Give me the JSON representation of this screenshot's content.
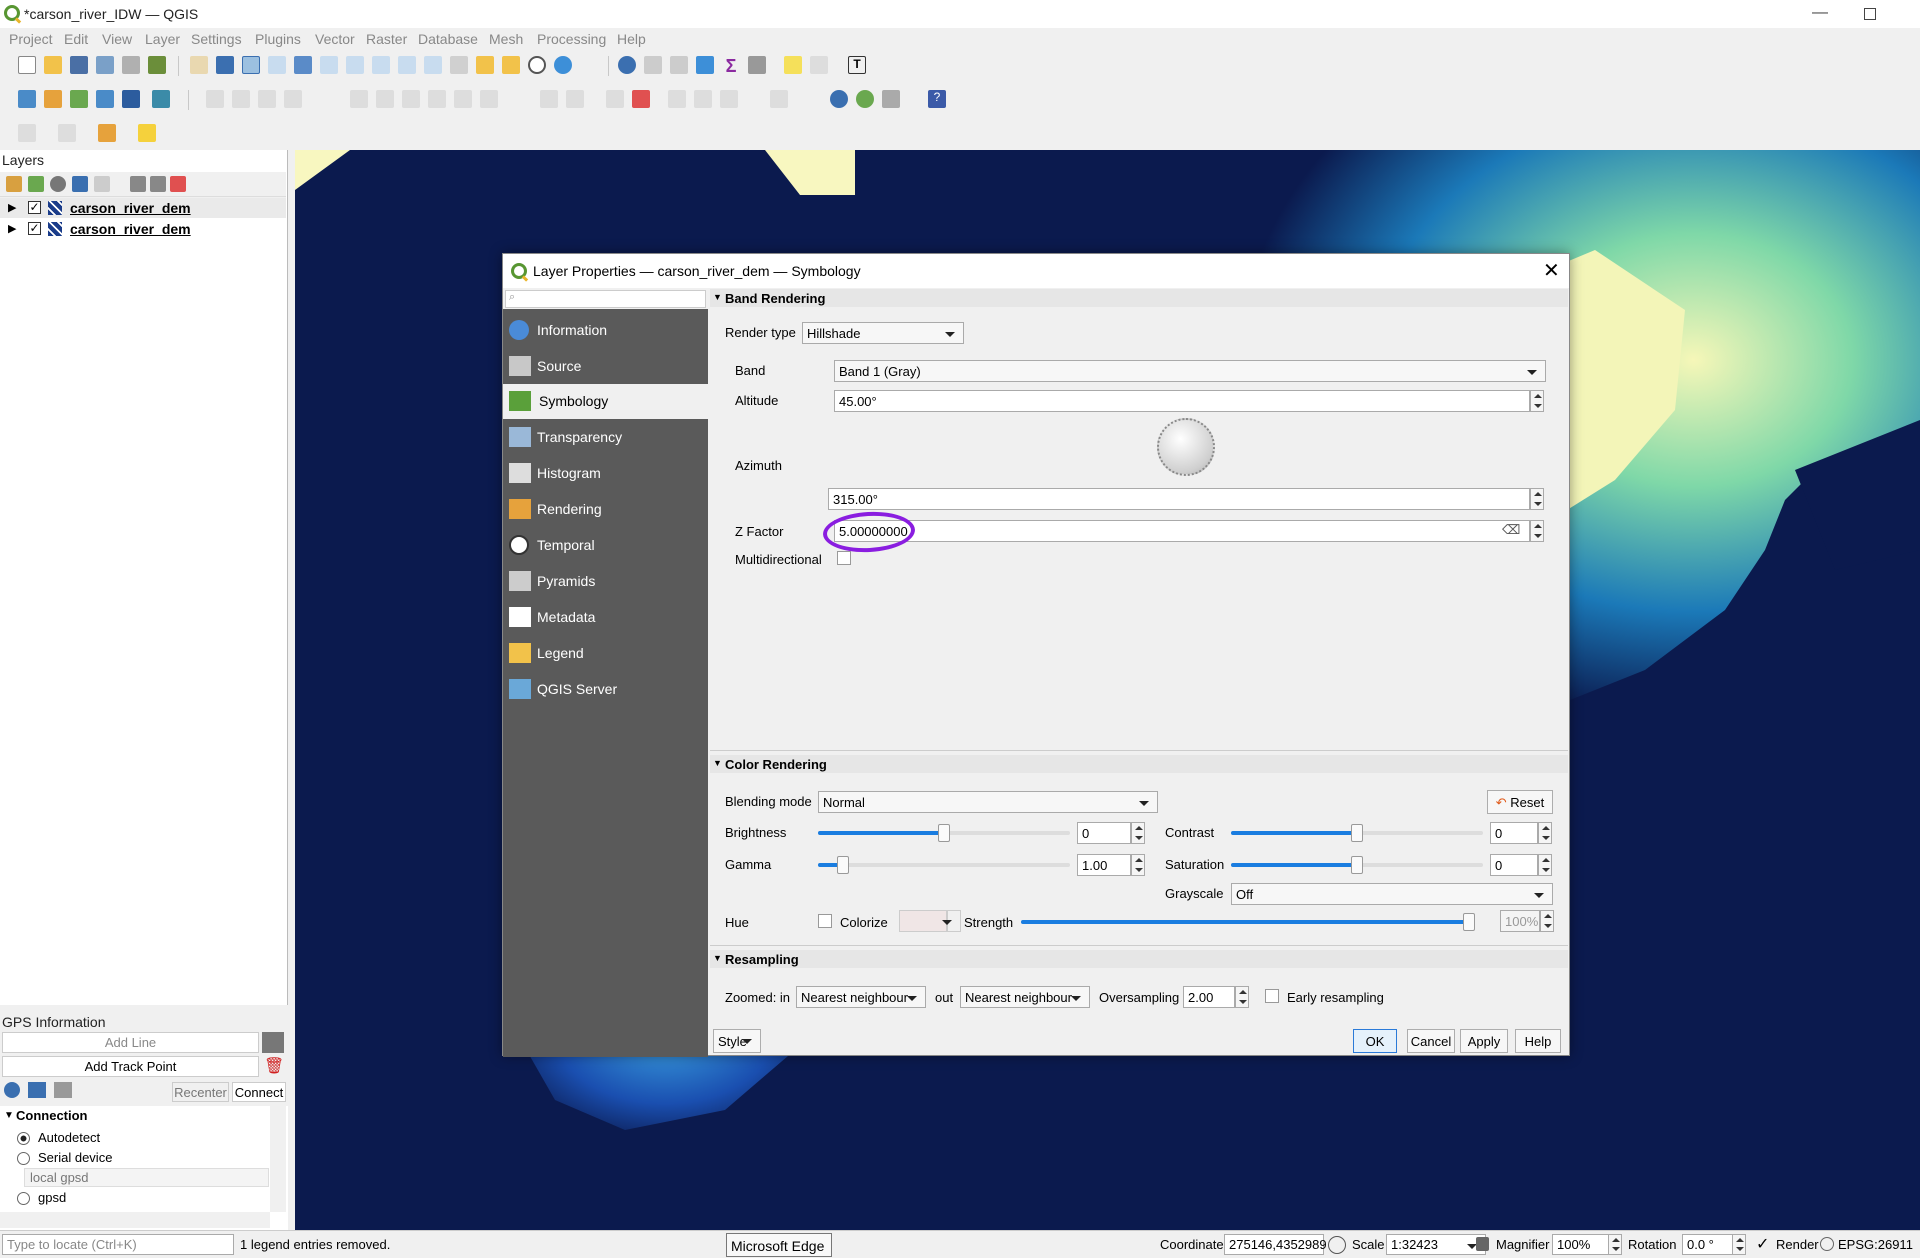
{
  "window": {
    "title": "*carson_river_IDW — QGIS"
  },
  "menubar": [
    "Project",
    "Edit",
    "View",
    "Layer",
    "Settings",
    "Plugins",
    "Vector",
    "Raster",
    "Database",
    "Mesh",
    "Processing",
    "Help"
  ],
  "layers_panel": {
    "title": "Layers",
    "layers": [
      {
        "name": "carson_river_dem",
        "checked": true
      },
      {
        "name": "carson_river_dem",
        "checked": true
      }
    ]
  },
  "gps": {
    "title": "GPS Information",
    "add_line": "Add Line",
    "add_track_point": "Add Track Point",
    "recenter": "Recenter",
    "connect": "Connect",
    "connection_header": "Connection",
    "options": [
      "Autodetect",
      "Serial device",
      "local gpsd",
      "gpsd"
    ],
    "selected": "Autodetect"
  },
  "statusbar": {
    "locate_placeholder": "Type to locate (Ctrl+K)",
    "message": "1 legend entries removed.",
    "taskbar_tooltip": "Microsoft Edge",
    "coordinate_label": "Coordinate",
    "coordinate": "275146,4352989",
    "scale_label": "Scale",
    "scale": "1:32423",
    "magnifier_label": "Magnifier",
    "magnifier": "100%",
    "rotation_label": "Rotation",
    "rotation": "0.0 °",
    "render_label": "Render",
    "crs": "EPSG:26911"
  },
  "dialog": {
    "title": "Layer Properties — carson_river_dem — Symbology",
    "nav": [
      "Information",
      "Source",
      "Symbology",
      "Transparency",
      "Histogram",
      "Rendering",
      "Temporal",
      "Pyramids",
      "Metadata",
      "Legend",
      "QGIS Server"
    ],
    "nav_selected": "Symbology",
    "band_rendering": {
      "header": "Band Rendering",
      "render_type_label": "Render type",
      "render_type": "Hillshade",
      "band_label": "Band",
      "band": "Band 1 (Gray)",
      "altitude_label": "Altitude",
      "altitude": "45.00°",
      "azimuth_label": "Azimuth",
      "azimuth": "315.00°",
      "zfactor_label": "Z Factor",
      "zfactor": "5.00000000",
      "multidirectional_label": "Multidirectional"
    },
    "color_rendering": {
      "header": "Color Rendering",
      "blending_label": "Blending mode",
      "blending": "Normal",
      "reset": "Reset",
      "brightness_label": "Brightness",
      "brightness": "0",
      "brightness_level": 0.5,
      "contrast_label": "Contrast",
      "contrast": "0",
      "contrast_level": 0.5,
      "gamma_label": "Gamma",
      "gamma": "1.00",
      "gamma_level": 0.1,
      "saturation_label": "Saturation",
      "saturation": "0",
      "saturation_level": 0.5,
      "grayscale_label": "Grayscale",
      "grayscale": "Off",
      "hue_label": "Hue",
      "colorize_label": "Colorize",
      "strength_label": "Strength",
      "strength": "100%",
      "strength_level": 1.0
    },
    "resampling": {
      "header": "Resampling",
      "zoomed_in_label": "Zoomed: in",
      "zoomed_in": "Nearest neighbour",
      "zoomed_out_label": "out",
      "zoomed_out": "Nearest neighbour",
      "oversampling_label": "Oversampling",
      "oversampling": "2.00",
      "early_label": "Early resampling"
    },
    "buttons": {
      "style": "Style",
      "ok": "OK",
      "cancel": "Cancel",
      "apply": "Apply",
      "help": "Help"
    },
    "annotation_color": "#8a1de0"
  }
}
